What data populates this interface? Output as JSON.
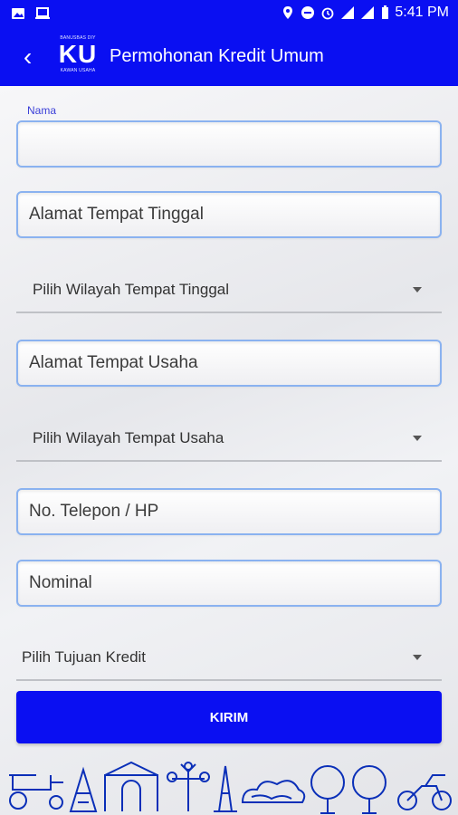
{
  "status_bar": {
    "time": "5:41 PM"
  },
  "app_bar": {
    "title": "Permohonan Kredit Umum",
    "logo_top": "BANUSBAS DIY",
    "logo_main": "KU",
    "logo_bottom": "KAWAN USAHA"
  },
  "form": {
    "name_label": "Nama",
    "name_value": "",
    "home_address_placeholder": "Alamat Tempat Tinggal",
    "home_region": "Pilih Wilayah Tempat Tinggal",
    "business_address_placeholder": "Alamat Tempat Usaha",
    "business_region": "Pilih Wilayah Tempat Usaha",
    "phone_placeholder": "No. Telepon / HP",
    "nominal_placeholder": "Nominal",
    "credit_purpose": "Pilih Tujuan Kredit",
    "submit_label": "KIRIM"
  },
  "colors": {
    "primary": "#0a0ff2",
    "field_border": "#8ab2f0"
  }
}
